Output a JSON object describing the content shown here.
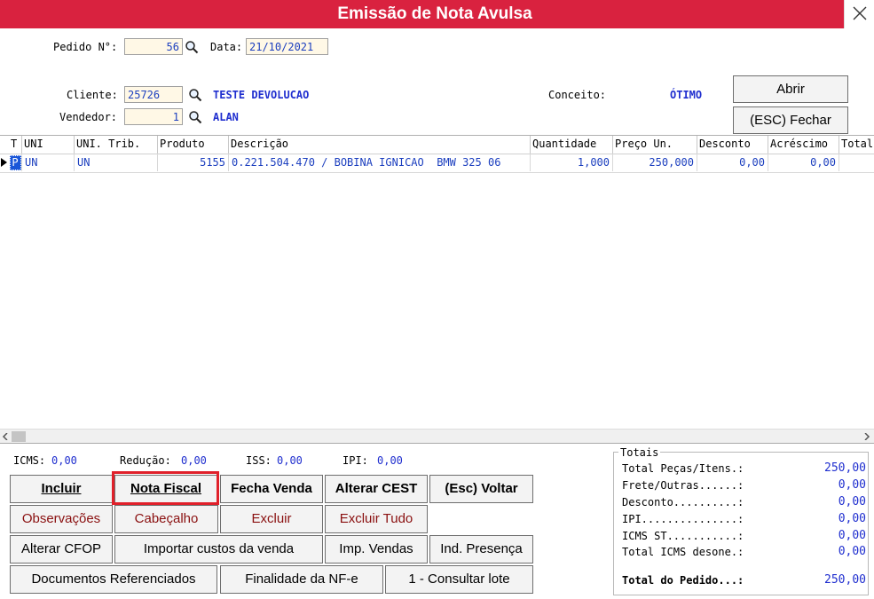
{
  "window": {
    "title": "Emissão de Nota Avulsa"
  },
  "header": {
    "pedido_label": "Pedido N°:",
    "pedido_value": "56",
    "data_label": "Data:",
    "data_value": "21/10/2021",
    "cliente_label": "Cliente:",
    "cliente_code": "25726",
    "cliente_name": "TESTE DEVOLUCAO",
    "vendedor_label": "Vendedor:",
    "vendedor_code": "1",
    "vendedor_name": "ALAN",
    "conceito_label": "Conceito:",
    "conceito_value": "ÓTIMO",
    "abrir_label": "Abrir",
    "fechar_label": "(ESC) Fechar"
  },
  "grid": {
    "columns": [
      "T",
      "UNI",
      "UNI. Trib.",
      "Produto",
      "Descrição",
      "Quantidade",
      "Preço Un.",
      "Desconto",
      "Acréscimo",
      "Total"
    ],
    "rows": [
      {
        "t": "P",
        "uni": "UN",
        "uni_trib": "UN",
        "produto": "5155",
        "descricao": "0.221.504.470 / BOBINA IGNICAO  BMW 325 06",
        "quantidade": "1,000",
        "preco": "250,000",
        "desconto": "0,00",
        "acrescimo": "0,00",
        "total": ""
      }
    ]
  },
  "taxes": {
    "icms_label": "ICMS:",
    "icms_value": "0,00",
    "reducao_label": "Redução:",
    "reducao_value": "0,00",
    "iss_label": "ISS:",
    "iss_value": "0,00",
    "ipi_label": "IPI:",
    "ipi_value": "0,00"
  },
  "buttons": {
    "incluir": "Incluir",
    "nota_fiscal": "Nota Fiscal",
    "fecha_venda": "Fecha Venda",
    "alterar_cest": "Alterar CEST",
    "voltar": "(Esc) Voltar",
    "observacoes": "Observações",
    "cabecalho": "Cabeçalho",
    "excluir": "Excluir",
    "excluir_tudo": "Excluir Tudo",
    "alterar_cfop": "Alterar CFOP",
    "importar_custos": "Importar custos da venda",
    "imp_vendas": "Imp. Vendas",
    "ind_presenca": "Ind. Presença",
    "documentos_ref": "Documentos Referenciados",
    "finalidade": "Finalidade da NF-e",
    "consultar_lote": "1 - Consultar lote"
  },
  "totals": {
    "group_label": "Totais",
    "items": [
      {
        "label": "Total Peças/Itens.:",
        "value": "250,00"
      },
      {
        "label": "Frete/Outras......:",
        "value": "0,00"
      },
      {
        "label": "Desconto..........:",
        "value": "0,00"
      },
      {
        "label": "IPI...............:",
        "value": "0,00"
      },
      {
        "label": "ICMS ST...........:",
        "value": "0,00"
      },
      {
        "label": "Total ICMS desone.:",
        "value": "0,00"
      }
    ],
    "pedido_label": "Total do Pedido...:",
    "pedido_value": "250,00"
  },
  "colors": {
    "title_bar": "#d9223f",
    "value_blue": "#1f2ecf",
    "highlight_border": "#e0202a"
  }
}
